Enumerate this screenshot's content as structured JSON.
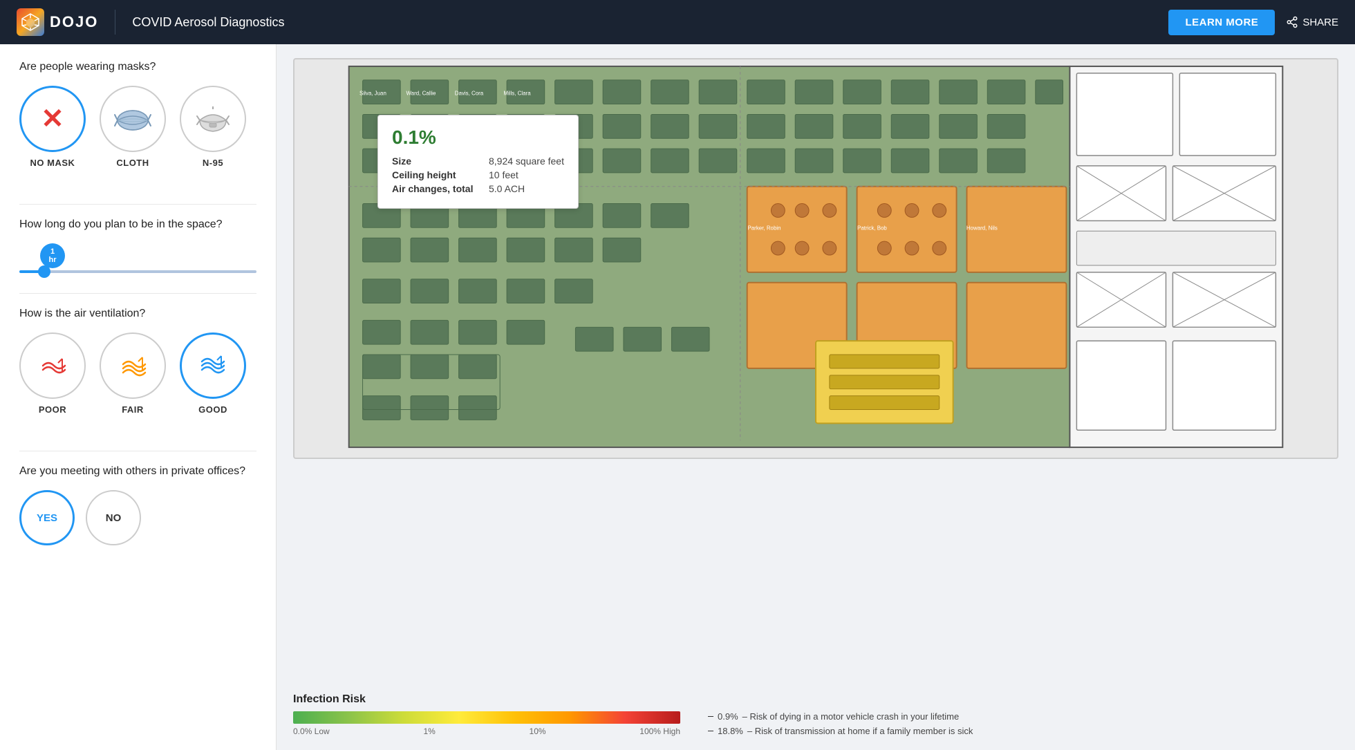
{
  "header": {
    "logo_text": "DOJO",
    "title": "COVID Aerosol Diagnostics",
    "learn_more": "LEARN MORE",
    "share": "SHARE"
  },
  "left_panel": {
    "mask_question": "Are people wearing masks?",
    "mask_options": [
      {
        "id": "no-mask",
        "label": "NO MASK",
        "selected": true
      },
      {
        "id": "cloth",
        "label": "CLOTH",
        "selected": false
      },
      {
        "id": "n95",
        "label": "N-95",
        "selected": false
      }
    ],
    "duration_question": "How long do you plan to be in the space?",
    "slider_label_line1": "1",
    "slider_label_line2": "hr",
    "ventilation_question": "How is the air ventilation?",
    "vent_options": [
      {
        "id": "poor",
        "label": "POOR",
        "selected": false
      },
      {
        "id": "fair",
        "label": "FAIR",
        "selected": false
      },
      {
        "id": "good",
        "label": "GOOD",
        "selected": true
      }
    ],
    "private_question": "Are you meeting with others in private offices?",
    "private_options": [
      {
        "id": "yes",
        "label": "YES",
        "selected": true
      },
      {
        "id": "no",
        "label": "NO",
        "selected": false
      }
    ]
  },
  "tooltip": {
    "percent": "0.1%",
    "size_label": "Size",
    "size_val": "8,924 square feet",
    "ceiling_label": "Ceiling height",
    "ceiling_val": "10 feet",
    "air_label": "Air changes, total",
    "air_val": "5.0 ACH"
  },
  "legend": {
    "title": "Infection Risk",
    "labels": [
      "0.0%  Low",
      "1%",
      "10%",
      "100%  High"
    ],
    "risk1_pct": "0.9%",
    "risk1_text": "– Risk of dying in a motor vehicle crash in your lifetime",
    "risk2_pct": "18.8%",
    "risk2_text": "– Risk of transmission at home if a family member is sick"
  }
}
